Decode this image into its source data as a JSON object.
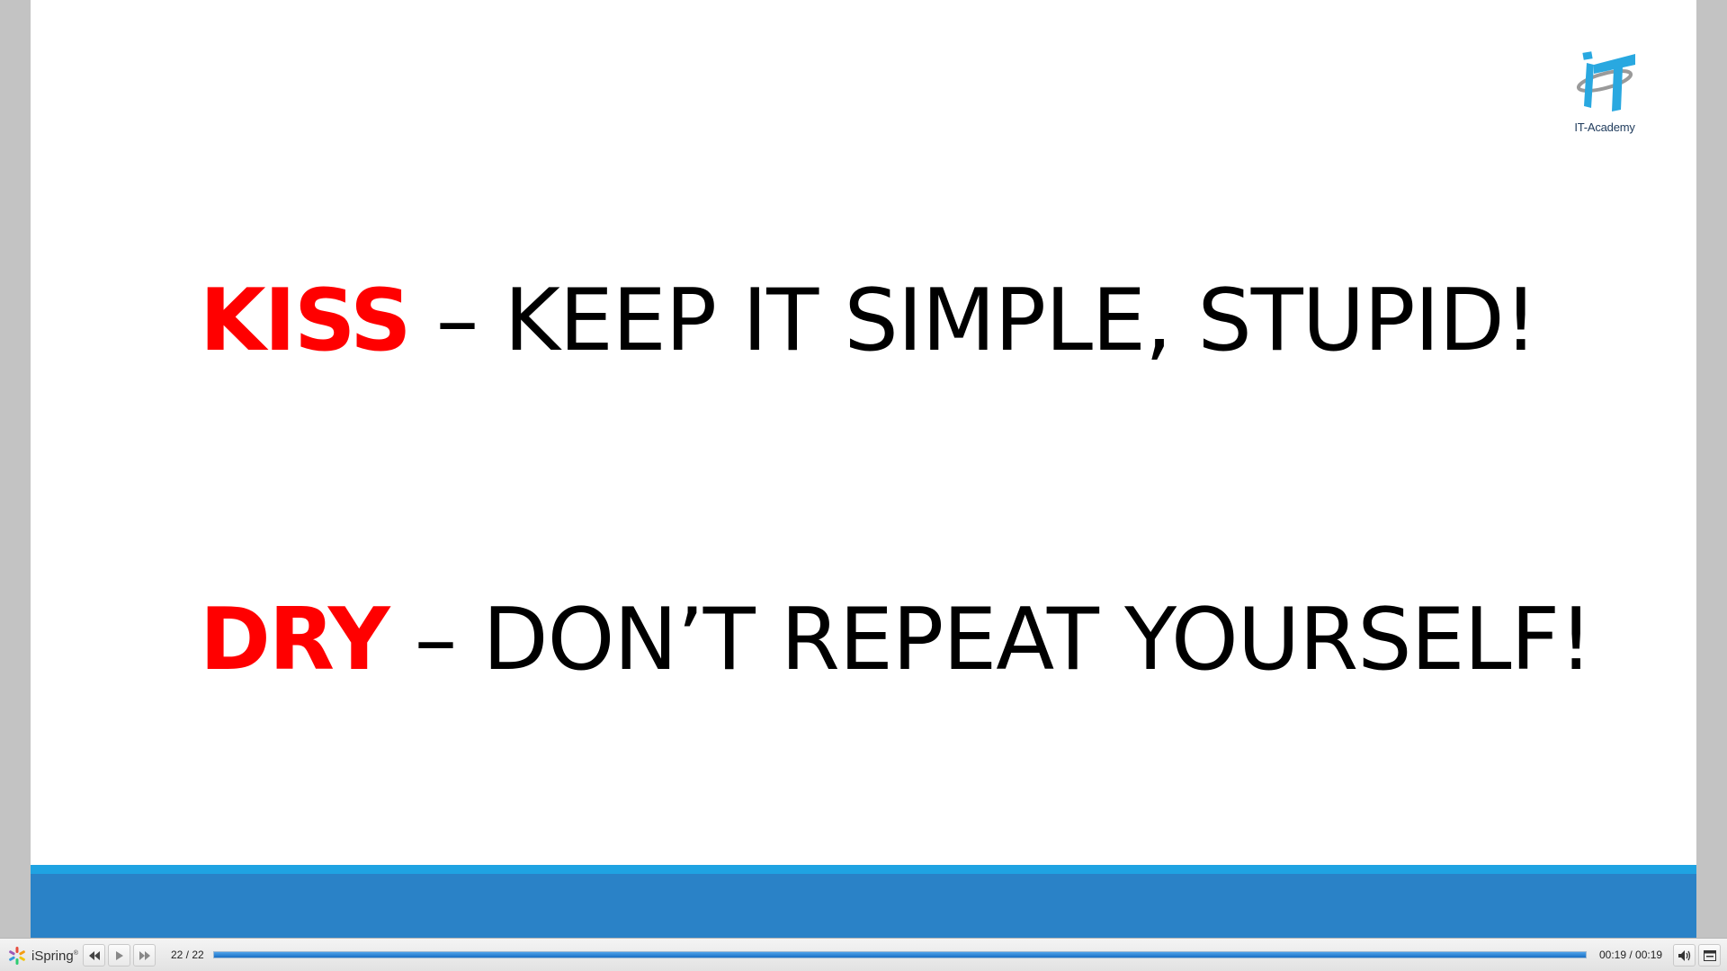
{
  "slide": {
    "logo_text": "IT-Academy",
    "line1": {
      "acronym": "KISS",
      "rest": " – KEEP IT SIMPLE, STUPID!"
    },
    "line2": {
      "acronym": "DRY",
      "rest": " – DON’T REPEAT YOURSELF!"
    }
  },
  "player": {
    "brand": "iSpring",
    "brand_mark": "®",
    "slide_counter": "22 / 22",
    "time": "00:19 / 00:19",
    "progress": 1.0,
    "icons": {
      "prev": "rewind-icon",
      "play": "play-icon",
      "next": "fast-forward-icon",
      "volume": "volume-icon",
      "fullscreen": "fullscreen-icon"
    }
  },
  "colors": {
    "acronym": "#ff0000",
    "band_light": "#1fa3e2",
    "band_dark": "#2a82c7",
    "progress": "#1a6fc4"
  }
}
